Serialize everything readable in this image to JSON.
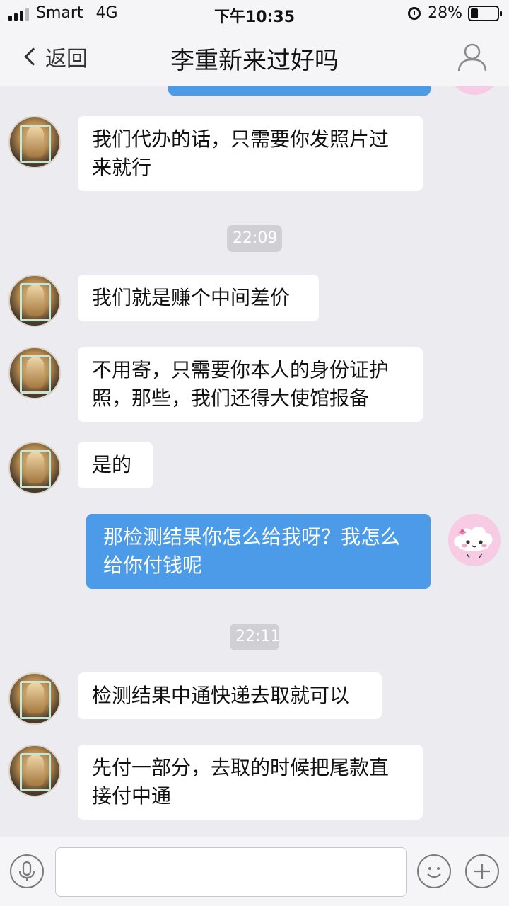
{
  "status_bar": {
    "carrier": "Smart",
    "network": "4G",
    "time": "下午10:35",
    "battery_percent_text": "28%",
    "battery_level": 0.28
  },
  "nav": {
    "back_label": "返回",
    "title": "李重新来过好吗"
  },
  "messages": [
    {
      "type": "left",
      "text_lines": [
        "我们代办的话，只需要你发照片过",
        "来就行"
      ]
    },
    {
      "type": "time",
      "text": "22:09"
    },
    {
      "type": "left",
      "text_lines": [
        "我们就是赚个中间差价"
      ]
    },
    {
      "type": "left",
      "text_lines": [
        "不用寄，只需要你本人的身份证护",
        "照，那些，我们还得大使馆报备"
      ]
    },
    {
      "type": "left",
      "text_lines": [
        "是的"
      ]
    },
    {
      "type": "right",
      "text_lines": [
        "那检测结果你怎么给我呀？我怎么",
        "给你付钱呢"
      ]
    },
    {
      "type": "time",
      "text": "22:11"
    },
    {
      "type": "left",
      "text_lines": [
        "检测结果中通快递去取就可以"
      ]
    },
    {
      "type": "left",
      "text_lines": [
        "先付一部分，去取的时候把尾款直",
        "接付中通"
      ]
    }
  ],
  "input": {
    "value": "",
    "placeholder": ""
  },
  "icons": {
    "back": "chevron-left-icon",
    "profile": "person-icon",
    "voice": "microphone-icon",
    "emoji": "smiley-icon",
    "more": "plus-icon"
  },
  "colors": {
    "outgoing_bubble": "#4b9be8",
    "incoming_bubble": "#ffffff",
    "background": "#ebebf0"
  }
}
